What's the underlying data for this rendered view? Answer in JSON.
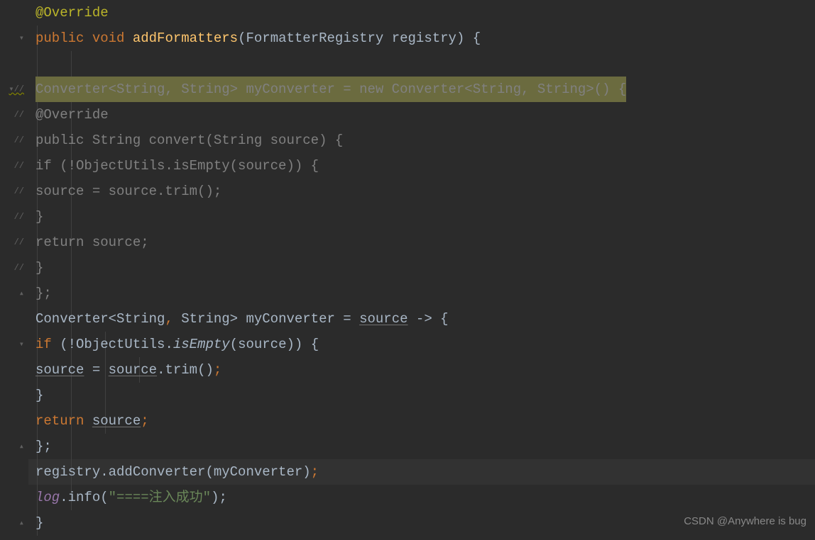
{
  "gutter": {
    "lines": [
      {
        "icon": ""
      },
      {
        "icon": "▾"
      },
      {
        "icon": ""
      },
      {
        "icon": "▾//",
        "warn": true
      },
      {
        "icon": "//"
      },
      {
        "icon": "//"
      },
      {
        "icon": "//"
      },
      {
        "icon": "//"
      },
      {
        "icon": "//"
      },
      {
        "icon": "//"
      },
      {
        "icon": "//"
      },
      {
        "icon": "▴"
      },
      {
        "icon": ""
      },
      {
        "icon": "▾"
      },
      {
        "icon": ""
      },
      {
        "icon": ""
      },
      {
        "icon": ""
      },
      {
        "icon": "▴"
      },
      {
        "icon": ""
      },
      {
        "icon": ""
      },
      {
        "icon": "▴"
      }
    ]
  },
  "code": {
    "l1_annotation": "@Override",
    "l2_public": "public",
    "l2_void": "void",
    "l2_method": "addFormatters",
    "l2_paren_open": "(",
    "l2_type": "FormatterRegistry",
    "l2_param": " registry",
    "l2_paren_close": ")",
    "l2_brace": " {",
    "l4_full": "Converter<String, String> myConverter = new Converter<String, String>() {",
    "l5_annotation": "@Override",
    "l6_text": "public String convert(String source) {",
    "l7_text": "if (!ObjectUtils.isEmpty(source)) {",
    "l8_text": "source = source.trim();",
    "l9_text": "}",
    "l10_text": "return source;",
    "l11_text": "}",
    "l12_text": "};",
    "l13_type": "Converter<String",
    "l13_comma": ",",
    "l13_type2": " String> myConverter = ",
    "l13_source": "source",
    "l13_arrow": " -> {",
    "l14_if": "if",
    "l14_paren": " (!ObjectUtils.",
    "l14_isEmpty": "isEmpty",
    "l14_rest": "(source)) {",
    "l15_source1": "source",
    "l15_eq": " = ",
    "l15_source2": "source",
    "l15_trim": ".trim()",
    "l15_semi": ";",
    "l16_brace": "}",
    "l17_return": "return",
    "l17_space": " ",
    "l17_source": "source",
    "l17_semi": ";",
    "l18_close": "};",
    "l19_reg": "registry.addConverter(myConverter)",
    "l19_semi": ";",
    "l20_log": "log",
    "l20_info": ".info(",
    "l20_string": "\"====注入成功\"",
    "l20_close": ");",
    "l21_brace": "}"
  },
  "watermark": "CSDN @Anywhere is bug"
}
